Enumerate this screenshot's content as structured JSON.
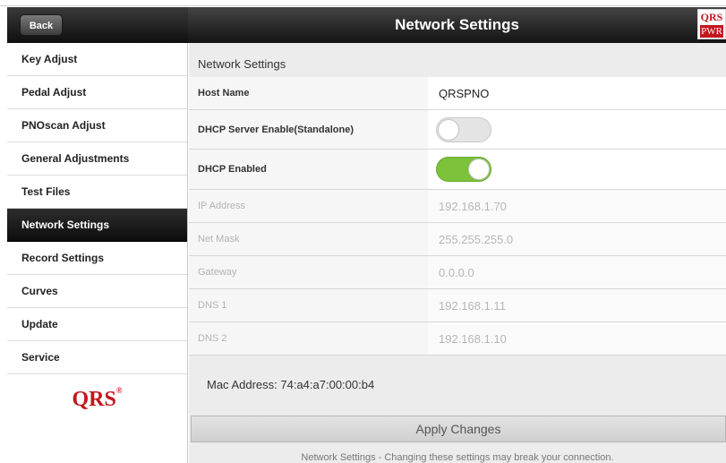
{
  "header": {
    "back_label": "Back",
    "title": "Network Settings",
    "logo_top": "QRS",
    "logo_bottom": "PWR"
  },
  "sidebar": {
    "items": [
      {
        "label": "Key Adjust"
      },
      {
        "label": "Pedal Adjust"
      },
      {
        "label": "PNOscan Adjust"
      },
      {
        "label": "General Adjustments"
      },
      {
        "label": "Test Files"
      },
      {
        "label": "Network Settings",
        "active": true
      },
      {
        "label": "Record Settings"
      },
      {
        "label": "Curves"
      },
      {
        "label": "Update"
      },
      {
        "label": "Service"
      }
    ],
    "logo_text": "QRS",
    "logo_mark": "®"
  },
  "main": {
    "section_title": "Network Settings",
    "rows": {
      "host_name": {
        "label": "Host Name",
        "value": "QRSPNO"
      },
      "dhcp_server": {
        "label": "DHCP Server Enable(Standalone)",
        "state": "off"
      },
      "dhcp_enabled": {
        "label": "DHCP Enabled",
        "state": "on"
      },
      "ip_address": {
        "label": "IP Address",
        "value": "192.168.1.70"
      },
      "net_mask": {
        "label": "Net Mask",
        "value": "255.255.255.0"
      },
      "gateway": {
        "label": "Gateway",
        "value": "0.0.0.0"
      },
      "dns1": {
        "label": "DNS 1",
        "value": "192.168.1.11"
      },
      "dns2": {
        "label": "DNS 2",
        "value": "192.168.1.10"
      }
    },
    "mac_address": "Mac Address: 74:a4:a7:00:00:b4",
    "apply_label": "Apply Changes",
    "warning": "Network Settings - Changing these settings may break your connection."
  },
  "colors": {
    "accent_red": "#c4161c",
    "toggle_on": "#7cc23a",
    "toggle_off": "#e4e4e4"
  }
}
